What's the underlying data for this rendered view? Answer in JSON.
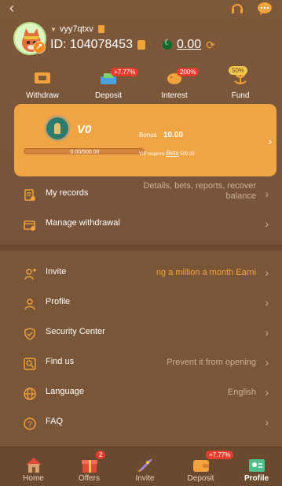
{
  "header": {
    "username": "vyy7qtxv",
    "id_label": "ID: 104078453",
    "balance": "0.00"
  },
  "quick_actions": [
    {
      "label": "Withdraw",
      "icon": "withdraw-ticket-icon",
      "badge": ""
    },
    {
      "label": "Deposit",
      "icon": "deposit-cash-icon",
      "badge": "+7.77%"
    },
    {
      "label": "Interest",
      "icon": "piggy-bank-icon",
      "badge": "200%"
    },
    {
      "label": "Fund",
      "icon": "fund-plant-icon",
      "badge": "50%"
    }
  ],
  "vip": {
    "level": "V0",
    "progress_text": "0.00/500.00",
    "progress": 0,
    "bonus_label": "Bonus",
    "bonus_value": "10.00",
    "requirement_prefix": "VIP requires ",
    "requirement_bets": "Bets",
    "requirement_value": " 500.00"
  },
  "menu_top": [
    {
      "label": "My records",
      "value": "Details, bets, reports, recover balance",
      "icon": "records-icon"
    },
    {
      "label": "Manage withdrawal",
      "value": "",
      "icon": "withdrawal-card-icon"
    }
  ],
  "menu_bottom": [
    {
      "label": "Invite",
      "value": "ng a million a month  Earni",
      "icon": "invite-user-icon"
    },
    {
      "label": "Profile",
      "value": "",
      "icon": "profile-user-icon"
    },
    {
      "label": "Security Center",
      "value": "",
      "icon": "shield-check-icon"
    },
    {
      "label": "Find us",
      "value": "Prevent it from opening",
      "icon": "find-search-icon"
    },
    {
      "label": "Language",
      "value": "English",
      "icon": "globe-icon"
    },
    {
      "label": "FAQ",
      "value": "",
      "icon": "question-icon"
    }
  ],
  "tabs": [
    {
      "label": "Home",
      "icon": "home-icon",
      "badge": ""
    },
    {
      "label": "Offers",
      "icon": "gift-icon",
      "badge": "2"
    },
    {
      "label": "Invite",
      "icon": "invite-rocket-icon",
      "badge": ""
    },
    {
      "label": "Deposit",
      "icon": "deposit-wallet-icon",
      "badge": "+7.77%"
    },
    {
      "label": "Profile",
      "icon": "profile-card-icon",
      "badge": ""
    }
  ],
  "colors": {
    "background": "#7a5638",
    "vip_card": "#f0a545",
    "accent": "#f2a23d",
    "badge_red": "#e63d2f"
  }
}
